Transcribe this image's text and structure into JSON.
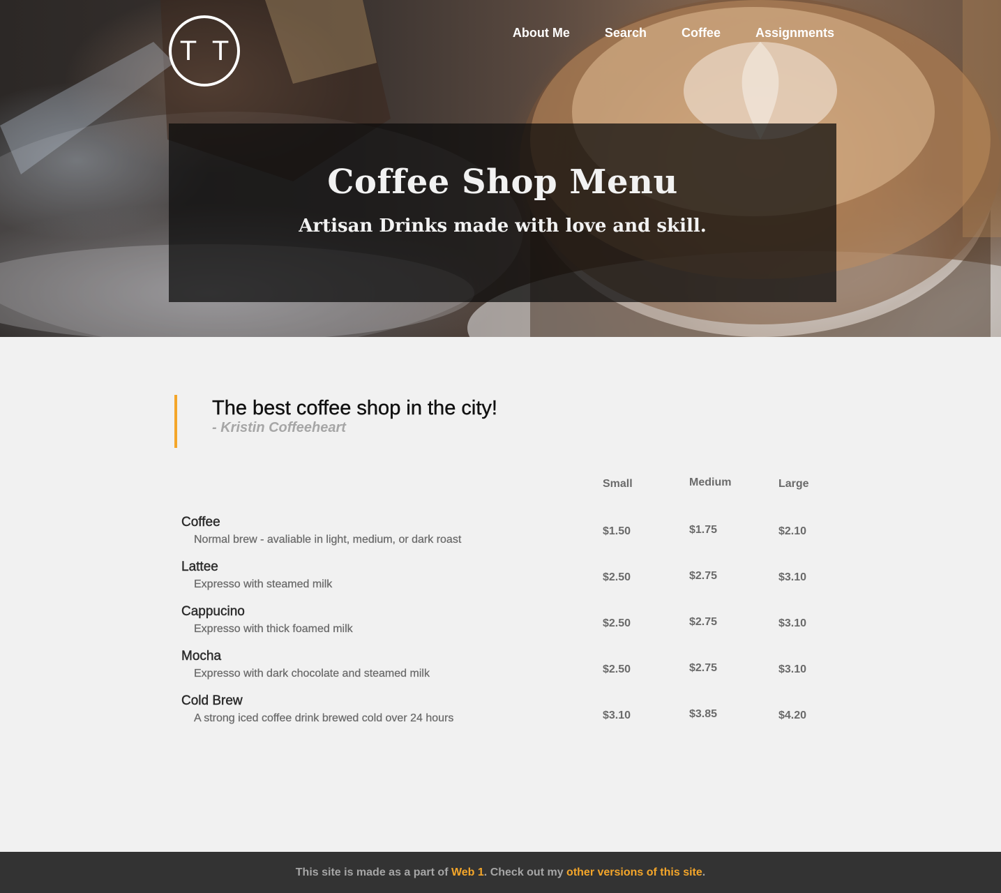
{
  "logo": {
    "text": "T T"
  },
  "nav": {
    "items": [
      {
        "label": "About Me"
      },
      {
        "label": "Search"
      },
      {
        "label": "Coffee"
      },
      {
        "label": "Assignments"
      }
    ]
  },
  "hero": {
    "title": "Coffee Shop Menu",
    "subtitle": "Artisan Drinks made with love and skill."
  },
  "quote": {
    "text": "The best coffee shop in the city!",
    "author": "- Kristin Coffeeheart"
  },
  "menu": {
    "columns": [
      "Small",
      "Medium",
      "Large"
    ],
    "items": [
      {
        "name": "Coffee",
        "description": "Normal brew - avaliable in light, medium, or dark roast",
        "prices": [
          "$1.50",
          "$1.75",
          "$2.10"
        ]
      },
      {
        "name": "Lattee",
        "description": "Expresso with steamed milk",
        "prices": [
          "$2.50",
          "$2.75",
          "$3.10"
        ]
      },
      {
        "name": "Cappucino",
        "description": "Expresso with thick foamed milk",
        "prices": [
          "$2.50",
          "$2.75",
          "$3.10"
        ]
      },
      {
        "name": "Mocha",
        "description": "Expresso with dark chocolate and steamed milk",
        "prices": [
          "$2.50",
          "$2.75",
          "$3.10"
        ]
      },
      {
        "name": "Cold Brew",
        "description": "A strong iced coffee drink brewed cold over 24 hours",
        "prices": [
          "$3.10",
          "$3.85",
          "$4.20"
        ]
      }
    ]
  },
  "footer": {
    "text_before": "This site is made as a part of ",
    "link1": "Web 1",
    "text_middle": ". Check out my ",
    "link2": "other versions of this site",
    "text_after": "."
  },
  "colors": {
    "accent": "#f4a62a",
    "footer_bg": "#333333",
    "page_bg": "#f1f1f1"
  }
}
